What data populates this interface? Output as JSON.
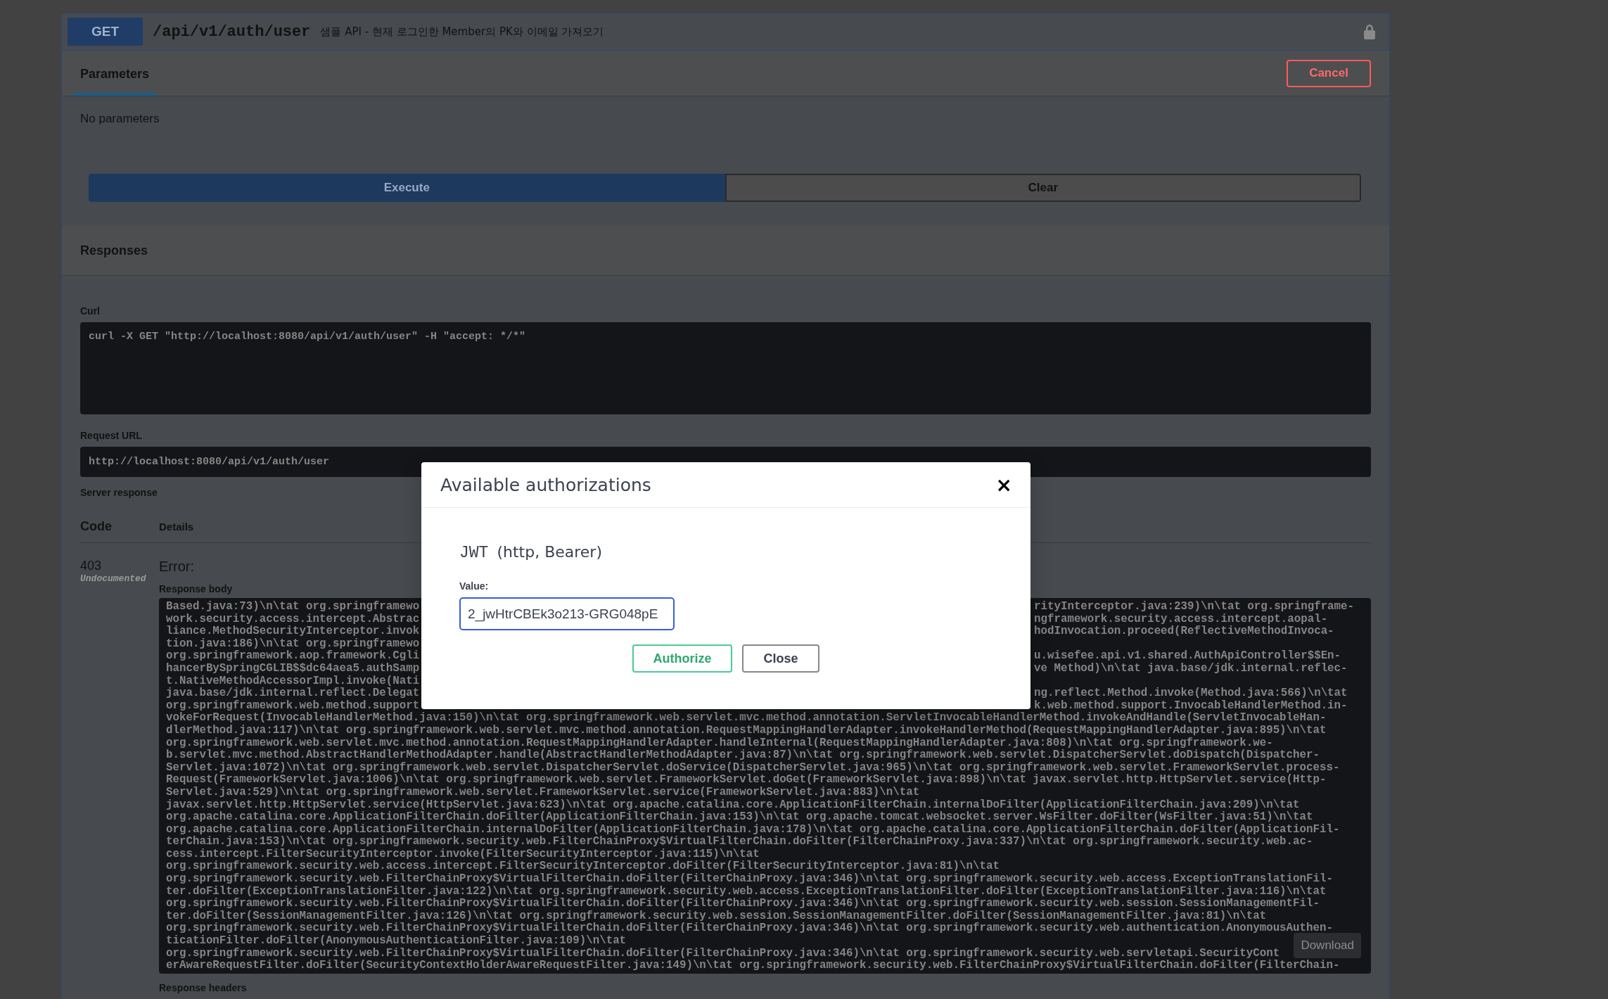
{
  "operation": {
    "method": "GET",
    "path": "/api/v1/auth/user",
    "summary": "샘플 API - 현재 로그인한 Member의 PK와 이메일 가져오기"
  },
  "tabs": [
    {
      "label": "Parameters",
      "selected": true
    }
  ],
  "cancel_button": "Cancel",
  "parameters_note": "No parameters",
  "actions": [
    {
      "label": "Execute",
      "kind": "primary"
    },
    {
      "label": "Clear",
      "kind": "secondary"
    }
  ],
  "responses_heading": "Responses",
  "curl": {
    "label": "Curl",
    "command": "curl -X GET \"http://localhost:8080/api/v1/auth/user\" -H \"accept: */*\""
  },
  "request_url": {
    "label": "Request URL",
    "url": "http://localhost:8080/api/v1/auth/user"
  },
  "server_response": {
    "label": "Server response",
    "columns": [
      "Code",
      "Details"
    ],
    "code": "403",
    "code_note": "Undocumented",
    "error": "Error:",
    "body_label": "Response body",
    "body_lines": [
      {
        "left": "Based.java:73)\\n\\tat org.springframewo",
        "right": "rityInterceptor.java:239)\\n\\tat org.springframe-"
      },
      {
        "left": "work.security.access.intercept.Abstrac",
        "right": "ngframework.security.access.intercept.aopal-"
      },
      {
        "left": "liance.MethodSecurityInterceptor.invok",
        "right": "hodInvocation.proceed(ReflectiveMethodInvoca-"
      },
      {
        "left": "tion.java:186)\\n\\tat org.springframewo"
      },
      {
        "left": "org.springframework.aop.framework.Cgli",
        "right": "u.wisefee.api.v1.shared.AuthApiController$$En-"
      },
      {
        "left": "hancerBySpringCGLIB$$dc64aea5.authSamp",
        "right": "ve Method)\\n\\tat java.base/jdk.internal.reflec-"
      },
      {
        "left": "t.NativeMethodAccessorImpl.invoke(Nati"
      },
      {
        "left": "java.base/jdk.internal.reflect.Delegat",
        "right": "ng.reflect.Method.invoke(Method.java:566)\\n\\tat"
      },
      {
        "left": "org.springframework.web.method.support",
        "right": "k.web.method.support.InvocableHandlerMethod.in-"
      },
      {
        "left": "vokeForRequest(InvocableHandlerMethod.java:150)\\n\\tat org.springframework.web.servlet.mvc.method.annotation.ServletInvocableHandlerMethod.invokeAndHandle(ServletInvocableHan-"
      },
      {
        "left": "dlerMethod.java:117)\\n\\tat org.springframework.web.servlet.mvc.method.annotation.RequestMappingHandlerAdapter.invokeHandlerMethod(RequestMappingHandlerAdapter.java:895)\\n\\tat"
      },
      {
        "left": "org.springframework.web.servlet.mvc.method.annotation.RequestMappingHandlerAdapter.handleInternal(RequestMappingHandlerAdapter.java:808)\\n\\tat org.springframework.we-"
      },
      {
        "left": "b.servlet.mvc.method.AbstractHandlerMethodAdapter.handle(AbstractHandlerMethodAdapter.java:87)\\n\\tat org.springframework.web.servlet.DispatcherServlet.doDispatch(Dispatcher-"
      },
      {
        "left": "Servlet.java:1072)\\n\\tat org.springframework.web.servlet.DispatcherServlet.doService(DispatcherServlet.java:965)\\n\\tat org.springframework.web.servlet.FrameworkServlet.process-"
      },
      {
        "left": "Request(FrameworkServlet.java:1006)\\n\\tat org.springframework.web.servlet.FrameworkServlet.doGet(FrameworkServlet.java:898)\\n\\tat javax.servlet.http.HttpServlet.service(Http-"
      },
      {
        "left": "Servlet.java:529)\\n\\tat org.springframework.web.servlet.FrameworkServlet.service(FrameworkServlet.java:883)\\n\\tat"
      },
      {
        "left": "javax.servlet.http.HttpServlet.service(HttpServlet.java:623)\\n\\tat org.apache.catalina.core.ApplicationFilterChain.internalDoFilter(ApplicationFilterChain.java:209)\\n\\tat"
      },
      {
        "left": "org.apache.catalina.core.ApplicationFilterChain.doFilter(ApplicationFilterChain.java:153)\\n\\tat org.apache.tomcat.websocket.server.WsFilter.doFilter(WsFilter.java:51)\\n\\tat"
      },
      {
        "left": "org.apache.catalina.core.ApplicationFilterChain.internalDoFilter(ApplicationFilterChain.java:178)\\n\\tat org.apache.catalina.core.ApplicationFilterChain.doFilter(ApplicationFil-"
      },
      {
        "left": "terChain.java:153)\\n\\tat org.springframework.security.web.FilterChainProxy$VirtualFilterChain.doFilter(FilterChainProxy.java:337)\\n\\tat org.springframework.security.web.ac-"
      },
      {
        "left": "cess.intercept.FilterSecurityInterceptor.invoke(FilterSecurityInterceptor.java:115)\\n\\tat"
      },
      {
        "left": "org.springframework.security.web.access.intercept.FilterSecurityInterceptor.doFilter(FilterSecurityInterceptor.java:81)\\n\\tat"
      },
      {
        "left": "org.springframework.security.web.FilterChainProxy$VirtualFilterChain.doFilter(FilterChainProxy.java:346)\\n\\tat org.springframework.security.web.access.ExceptionTranslationFil-"
      },
      {
        "left": "ter.doFilter(ExceptionTranslationFilter.java:122)\\n\\tat org.springframework.security.web.access.ExceptionTranslationFilter.doFilter(ExceptionTranslationFilter.java:116)\\n\\tat"
      },
      {
        "left": "org.springframework.security.web.FilterChainProxy$VirtualFilterChain.doFilter(FilterChainProxy.java:346)\\n\\tat org.springframework.security.web.session.SessionManagementFil-"
      },
      {
        "left": "ter.doFilter(SessionManagementFilter.java:126)\\n\\tat org.springframework.security.web.session.SessionManagementFilter.doFilter(SessionManagementFilter.java:81)\\n\\tat"
      },
      {
        "left": "org.springframework.security.web.FilterChainProxy$VirtualFilterChain.doFilter(FilterChainProxy.java:346)\\n\\tat org.springframework.security.web.authentication.AnonymousAuthen-"
      },
      {
        "left": "ticationFilter.doFilter(AnonymousAuthenticationFilter.java:109)\\n\\tat"
      },
      {
        "left": "org.springframework.security.web.FilterChainProxy$VirtualFilterChain.doFilter(FilterChainProxy.java:346)\\n\\tat org.springframework.security.web.servletapi.SecurityCont"
      },
      {
        "left": "erAwareRequestFilter.doFilter(SecurityContextHolderAwareRequestFilter.java:149)\\n\\tat org.springframework.security.web.FilterChainProxy$VirtualFilterChain.doFilter(FilterChain-"
      }
    ],
    "download": "Download",
    "headers_label": "Response headers"
  },
  "modal": {
    "title": "Available authorizations",
    "close": "×",
    "scheme": {
      "name": "JWT",
      "type": "(http, Bearer)"
    },
    "value_label": "Value:",
    "value": "2_jwHtrCBEk3o213-GRG048pE",
    "buttons": [
      {
        "label": "Authorize",
        "kind": "authorize"
      },
      {
        "label": "Close",
        "kind": "close"
      }
    ]
  }
}
